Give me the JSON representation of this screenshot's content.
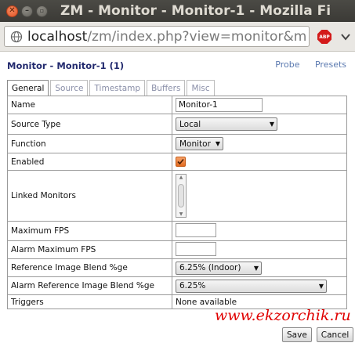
{
  "window": {
    "title": "ZM - Monitor - Monitor-1 - Mozilla Fi"
  },
  "browser": {
    "url_host": "localhost",
    "url_rest": "/zm/index.php?view=monitor&m",
    "abp_label": "ABP"
  },
  "page": {
    "heading": "Monitor - Monitor-1 (1)",
    "links": [
      "Probe",
      "Presets"
    ]
  },
  "tabs": [
    "General",
    "Source",
    "Timestamp",
    "Buffers",
    "Misc"
  ],
  "form": {
    "name_label": "Name",
    "name_value": "Monitor-1",
    "source_type_label": "Source Type",
    "source_type_value": "Local",
    "function_label": "Function",
    "function_value": "Monitor",
    "enabled_label": "Enabled",
    "enabled_checked": true,
    "linked_label": "Linked Monitors",
    "max_fps_label": "Maximum FPS",
    "max_fps_value": "",
    "alarm_max_fps_label": "Alarm Maximum FPS",
    "alarm_max_fps_value": "",
    "ref_blend_label": "Reference Image Blend %ge",
    "ref_blend_value": "6.25% (Indoor)",
    "alarm_ref_blend_label": "Alarm Reference Image Blend %ge",
    "alarm_ref_blend_value": "6.25%",
    "triggers_label": "Triggers",
    "triggers_value": "None available"
  },
  "actions": {
    "save_label": "Save",
    "cancel_label": "Cancel"
  },
  "watermark": "www.ekzorchik.ru",
  "colors": {
    "accent_orange": "#e26a1f",
    "heading_blue": "#222a6e",
    "link_blue": "#5b7ab0",
    "watermark_red": "#e00000"
  }
}
